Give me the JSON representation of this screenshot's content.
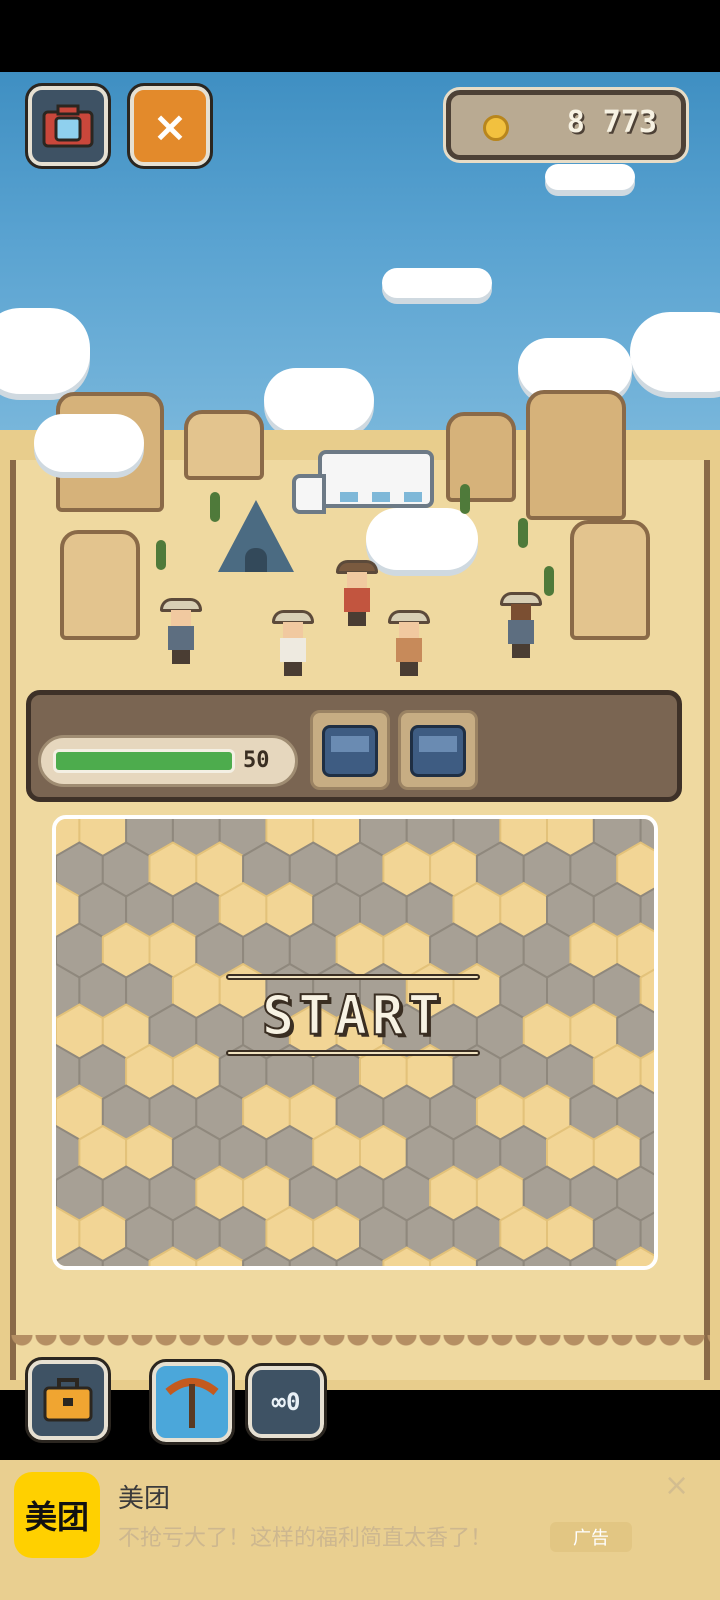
{
  "header": {
    "close_symbol": "×",
    "coins": "8 773"
  },
  "icons": {
    "camera": "camera-icon",
    "close": "close-icon",
    "coin": "coin-icon",
    "toolbox": "toolbox-icon",
    "pickaxe": "pickaxe-icon",
    "cart": "mine-cart-icon"
  },
  "dig": {
    "stamina_value": "50",
    "stamina_fraction": 1.0,
    "start_label": "START"
  },
  "tools": {
    "pickaxe_count": "∞0"
  },
  "ad": {
    "logo_text": "美团",
    "title": "美团",
    "description": "不抢亏大了！这样的福利简直太香了！",
    "tag": "广告",
    "close": "×"
  },
  "colors": {
    "sky": "#4f9ccc",
    "sand": "#efd9a0",
    "stamina_green": "#4dac4d",
    "close_orange": "#e38a2b",
    "pickaxe_blue": "#4ba7da",
    "ad_logo_yellow": "#ffd000"
  }
}
